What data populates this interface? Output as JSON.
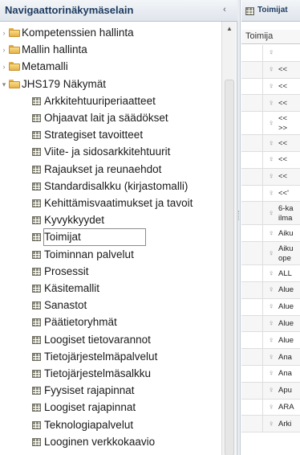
{
  "navigator": {
    "title": "Navigaattorinäkymäselain",
    "collapse_glyph": "‹",
    "items": [
      {
        "label": "Kompetenssien hallinta",
        "type": "folder",
        "expanded": false,
        "level": 0
      },
      {
        "label": "Mallin hallinta",
        "type": "folder",
        "expanded": false,
        "level": 0
      },
      {
        "label": "Metamalli",
        "type": "folder",
        "expanded": false,
        "level": 0
      },
      {
        "label": "JHS179 Näkymät",
        "type": "folder",
        "expanded": true,
        "level": 0
      },
      {
        "label": "Arkkitehtuuriperiaatteet",
        "type": "view",
        "level": 1
      },
      {
        "label": "Ohjaavat lait ja säädökset",
        "type": "view",
        "level": 1
      },
      {
        "label": "Strategiset tavoitteet",
        "type": "view",
        "level": 1
      },
      {
        "label": "Viite- ja sidosarkkitehtuurit",
        "type": "view",
        "level": 1
      },
      {
        "label": "Rajaukset ja reunaehdot",
        "type": "view",
        "level": 1
      },
      {
        "label": "Standardisalkku (kirjastomalli)",
        "type": "view",
        "level": 1
      },
      {
        "label": "Kehittämisvaatimukset ja tavoit",
        "type": "view",
        "level": 1
      },
      {
        "label": "Kyvykkyydet",
        "type": "view",
        "level": 1
      },
      {
        "label": "Toimijat",
        "type": "view",
        "level": 1,
        "selected": true
      },
      {
        "label": "Toiminnan palvelut",
        "type": "view",
        "level": 1
      },
      {
        "label": "Prosessit",
        "type": "view",
        "level": 1
      },
      {
        "label": "Käsitemallit",
        "type": "view",
        "level": 1
      },
      {
        "label": "Sanastot",
        "type": "view",
        "level": 1
      },
      {
        "label": "Päätietoryhmät",
        "type": "view",
        "level": 1
      },
      {
        "label": "Loogiset tietovarannot",
        "type": "view",
        "level": 1
      },
      {
        "label": "Tietojärjestelmäpalvelut",
        "type": "view",
        "level": 1
      },
      {
        "label": "Tietojärjestelmäsalkku",
        "type": "view",
        "level": 1
      },
      {
        "label": "Fyysiset rajapinnat",
        "type": "view",
        "level": 1
      },
      {
        "label": "Loogiset rajapinnat",
        "type": "view",
        "level": 1
      },
      {
        "label": "Teknologiapalvelut",
        "type": "view",
        "level": 1
      },
      {
        "label": "Looginen verkkokaavio",
        "type": "view",
        "level": 1
      }
    ]
  },
  "detail": {
    "title": "Toimijat",
    "column_header": "Toimija",
    "rows": [
      {
        "text": ""
      },
      {
        "text": "<<"
      },
      {
        "text": "<<"
      },
      {
        "text": "<<"
      },
      {
        "text": "<<\n>>"
      },
      {
        "text": "<<"
      },
      {
        "text": "<<"
      },
      {
        "text": "<<"
      },
      {
        "text": "<<'"
      },
      {
        "text": "6-ka\nilma"
      },
      {
        "text": "Aiku"
      },
      {
        "text": "Aiku\nope"
      },
      {
        "text": "ALL"
      },
      {
        "text": "Alue"
      },
      {
        "text": "Alue"
      },
      {
        "text": "Alue"
      },
      {
        "text": "Alue"
      },
      {
        "text": "Ana"
      },
      {
        "text": "Ana"
      },
      {
        "text": "Apu"
      },
      {
        "text": "ARA"
      },
      {
        "text": "Arki"
      }
    ]
  },
  "colors": {
    "header_text": "#1c3a5e",
    "folder_yellow": "#e6b24a",
    "selection_border": "#8c8c8c"
  }
}
